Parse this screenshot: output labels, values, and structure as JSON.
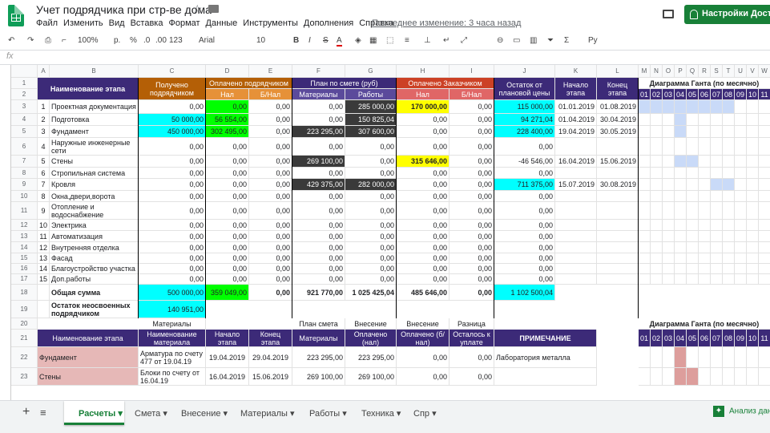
{
  "title": "Учет подрядчика при стр-ве дома",
  "menu": [
    "Файл",
    "Изменить",
    "Вид",
    "Вставка",
    "Формат",
    "Данные",
    "Инструменты",
    "Дополнения",
    "Справка"
  ],
  "last_edit": "Последнее изменение: 3 часа назад",
  "settings_button": "Настройки Доступа",
  "toolbar": {
    "zoom": "100%",
    "currency": "р.",
    "percent": "%",
    "dec1": ".0",
    "dec2": ".00",
    "format": "123",
    "font": "Arial",
    "size": "10",
    "bold": "B",
    "italic": "I",
    "strike": "S",
    "color": "A",
    "sum": "Σ",
    "script": "Ру"
  },
  "fx": "fx",
  "col_headers": [
    "",
    "A",
    "B",
    "C",
    "D",
    "E",
    "F",
    "G",
    "H",
    "I",
    "J",
    "K",
    "L",
    "M",
    "N",
    "O",
    "P",
    "Q",
    "R",
    "S",
    "T",
    "U",
    "V",
    "W"
  ],
  "headers": {
    "name": "Наименование этапа",
    "received": "Получено подрядчиком",
    "paid_contractor": "Оплачено подрядчиком",
    "cash": "Нал",
    "noncash": "Б/Нал",
    "plan": "План по смете (руб)",
    "materials": "Материалы",
    "works": "Работы",
    "paid_customer": "Оплачено Заказчиком",
    "remain": "Остаток от плановой цены",
    "start": "Начало этапа",
    "end": "Конец этапа",
    "gantt": "Диаграмма Ганта (по месячно)",
    "months": [
      "01",
      "02",
      "03",
      "04",
      "05",
      "06",
      "07",
      "08",
      "09",
      "10",
      "11"
    ]
  },
  "rows": [
    {
      "n": "3",
      "i": "1",
      "name": "Проектная документация",
      "c": "0,00",
      "d": "0,00",
      "e": "0,00",
      "f": "0,00",
      "g": "285 000,00",
      "h": "170 000,00",
      "ii": "0,00",
      "j": "115 000,00",
      "k": "01.01.2019",
      "l": "01.08.2019"
    },
    {
      "n": "4",
      "i": "2",
      "name": "Подготовка",
      "c": "50 000,00",
      "d": "56 554,00",
      "e": "0,00",
      "f": "0,00",
      "g": "150 825,04",
      "h": "0,00",
      "ii": "0,00",
      "j": "94 271,04",
      "k": "01.04.2019",
      "l": "30.04.2019"
    },
    {
      "n": "5",
      "i": "3",
      "name": "Фундамент",
      "c": "450 000,00",
      "d": "302 495,00",
      "e": "0,00",
      "f": "223 295,00",
      "g": "307 600,00",
      "h": "0,00",
      "ii": "0,00",
      "j": "228 400,00",
      "k": "19.04.2019",
      "l": "30.05.2019"
    },
    {
      "n": "6",
      "i": "4",
      "name": "Наружные инженерные сети",
      "c": "0,00",
      "d": "0,00",
      "e": "0,00",
      "f": "0,00",
      "g": "0,00",
      "h": "0,00",
      "ii": "0,00",
      "j": "0,00",
      "k": "",
      "l": ""
    },
    {
      "n": "7",
      "i": "5",
      "name": "Стены",
      "c": "0,00",
      "d": "0,00",
      "e": "0,00",
      "f": "269 100,00",
      "g": "0,00",
      "h": "315 646,00",
      "ii": "0,00",
      "j": "-46 546,00",
      "k": "16.04.2019",
      "l": "15.06.2019"
    },
    {
      "n": "8",
      "i": "6",
      "name": "Стропильная система",
      "c": "0,00",
      "d": "0,00",
      "e": "0,00",
      "f": "0,00",
      "g": "0,00",
      "h": "0,00",
      "ii": "0,00",
      "j": "0,00",
      "k": "",
      "l": ""
    },
    {
      "n": "9",
      "i": "7",
      "name": "Кровля",
      "c": "0,00",
      "d": "0,00",
      "e": "0,00",
      "f": "429 375,00",
      "g": "282 000,00",
      "h": "0,00",
      "ii": "0,00",
      "j": "711 375,00",
      "k": "15.07.2019",
      "l": "30.08.2019"
    },
    {
      "n": "10",
      "i": "8",
      "name": "Окна,двери,ворота",
      "c": "0,00",
      "d": "0,00",
      "e": "0,00",
      "f": "0,00",
      "g": "0,00",
      "h": "0,00",
      "ii": "0,00",
      "j": "0,00",
      "k": "",
      "l": ""
    },
    {
      "n": "11",
      "i": "9",
      "name": "Отопление и водоснабжение",
      "c": "0,00",
      "d": "0,00",
      "e": "0,00",
      "f": "0,00",
      "g": "0,00",
      "h": "0,00",
      "ii": "0,00",
      "j": "0,00",
      "k": "",
      "l": ""
    },
    {
      "n": "12",
      "i": "10",
      "name": "Электрика",
      "c": "0,00",
      "d": "0,00",
      "e": "0,00",
      "f": "0,00",
      "g": "0,00",
      "h": "0,00",
      "ii": "0,00",
      "j": "0,00",
      "k": "",
      "l": ""
    },
    {
      "n": "13",
      "i": "11",
      "name": "Автоматизация",
      "c": "0,00",
      "d": "0,00",
      "e": "0,00",
      "f": "0,00",
      "g": "0,00",
      "h": "0,00",
      "ii": "0,00",
      "j": "0,00",
      "k": "",
      "l": ""
    },
    {
      "n": "14",
      "i": "12",
      "name": "Внутренняя отделка",
      "c": "0,00",
      "d": "0,00",
      "e": "0,00",
      "f": "0,00",
      "g": "0,00",
      "h": "0,00",
      "ii": "0,00",
      "j": "0,00",
      "k": "",
      "l": ""
    },
    {
      "n": "15",
      "i": "13",
      "name": "Фасад",
      "c": "0,00",
      "d": "0,00",
      "e": "0,00",
      "f": "0,00",
      "g": "0,00",
      "h": "0,00",
      "ii": "0,00",
      "j": "0,00",
      "k": "",
      "l": ""
    },
    {
      "n": "16",
      "i": "14",
      "name": "Благоустройство участка",
      "c": "0,00",
      "d": "0,00",
      "e": "0,00",
      "f": "0,00",
      "g": "0,00",
      "h": "0,00",
      "ii": "0,00",
      "j": "0,00",
      "k": "",
      "l": ""
    },
    {
      "n": "17",
      "i": "15",
      "name": "Доп.работы",
      "c": "0,00",
      "d": "0,00",
      "e": "0,00",
      "f": "0,00",
      "g": "0,00",
      "h": "0,00",
      "ii": "0,00",
      "j": "0,00",
      "k": "",
      "l": ""
    }
  ],
  "total": {
    "n": "18",
    "name": "Общая сумма",
    "c": "500 000,00",
    "d": "359 049,00",
    "e": "0,00",
    "f": "921 770,00",
    "g": "1 025 425,04",
    "h": "485 646,00",
    "ii": "0,00",
    "j": "1 102 500,04"
  },
  "unused": {
    "n": "19",
    "name": "Остаток неосвоенных подрядчиком",
    "c": "140 951,00"
  },
  "row20": {
    "n": "20",
    "c": "Материалы",
    "f": "План смета",
    "g": "Внесение",
    "h": "Внесение",
    "ii": "Разница",
    "gantt": "Диаграмма Ганта (по месячно)"
  },
  "row21": {
    "n": "21",
    "name": "Наименование этапа",
    "c": "Наименование материала",
    "d": "Начало этапа",
    "e": "Конец этапа",
    "f": "Материалы",
    "g": "Оплачено (нал)",
    "h": "Оплачено (б/нал)",
    "ii": "Осталось к уплате",
    "j": "ПРИМЕЧАНИЕ"
  },
  "row22": {
    "n": "22",
    "name": "Фундамент",
    "c": "Арматура по счету 477 от 19.04.19",
    "d": "19.04.2019",
    "e": "29.04.2019",
    "f": "223 295,00",
    "g": "223 295,00",
    "h": "0,00",
    "ii": "0,00",
    "j": "Лаборатория металла"
  },
  "row23": {
    "n": "23",
    "name": "Стены",
    "c": "Блоки по счету от 16.04.19",
    "d": "16.04.2019",
    "e": "15.06.2019",
    "f": "269 100,00",
    "g": "269 100,00",
    "h": "0,00",
    "ii": "0,00"
  },
  "tabs": [
    "Расчеты",
    "Смета",
    "Внесение",
    "Материалы",
    "Работы",
    "Техника",
    "Спр"
  ],
  "explore": "Анализ данных",
  "colors": {
    "purple": "#3c2a78",
    "brown": "#b45f06",
    "orange": "#e69138",
    "red": "#cc4125",
    "redlight": "#e06666",
    "green": "#00ff00",
    "cyan": "#00ffff",
    "yellow": "#ffff00",
    "dark": "#3a3a3a",
    "gantt": "#c9daf8",
    "pink": "#e6b8b7"
  }
}
